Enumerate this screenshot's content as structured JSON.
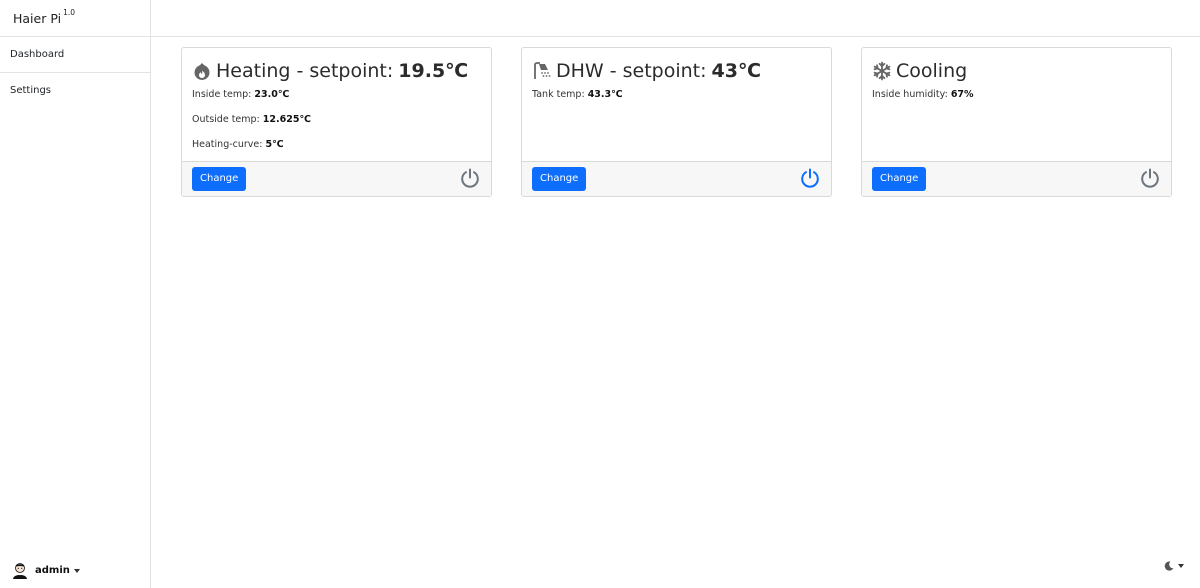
{
  "app": {
    "name": "Haier Pi",
    "version": "1.0"
  },
  "sidebar": {
    "items": [
      {
        "label": "Dashboard"
      },
      {
        "label": "Settings"
      }
    ],
    "user": {
      "name": "admin"
    }
  },
  "cards": {
    "heating": {
      "icon": "flame-icon",
      "title": "Heating - setpoint:",
      "setpoint": "19.5℃",
      "stats": [
        {
          "label": "Inside temp:",
          "value": "23.0℃"
        },
        {
          "label": "Outside temp:",
          "value": "12.625℃"
        },
        {
          "label": "Heating-curve:",
          "value": "5℃"
        }
      ],
      "button": "Change",
      "power": "off"
    },
    "dhw": {
      "icon": "shower-icon",
      "title": "DHW - setpoint:",
      "setpoint": "43℃",
      "stats": [
        {
          "label": "Tank temp:",
          "value": "43.3℃"
        }
      ],
      "button": "Change",
      "power": "on"
    },
    "cooling": {
      "icon": "snowflake-icon",
      "title": "Cooling",
      "stats": [
        {
          "label": "Inside humidity:",
          "value": "67%"
        }
      ],
      "button": "Change",
      "power": "off"
    }
  },
  "colors": {
    "primary": "#0d6efd",
    "power_on": "#0d6efd",
    "power_off": "#6c757d",
    "border": "#d9d9d9"
  },
  "theme_toggle": {
    "icon": "moon-icon"
  }
}
